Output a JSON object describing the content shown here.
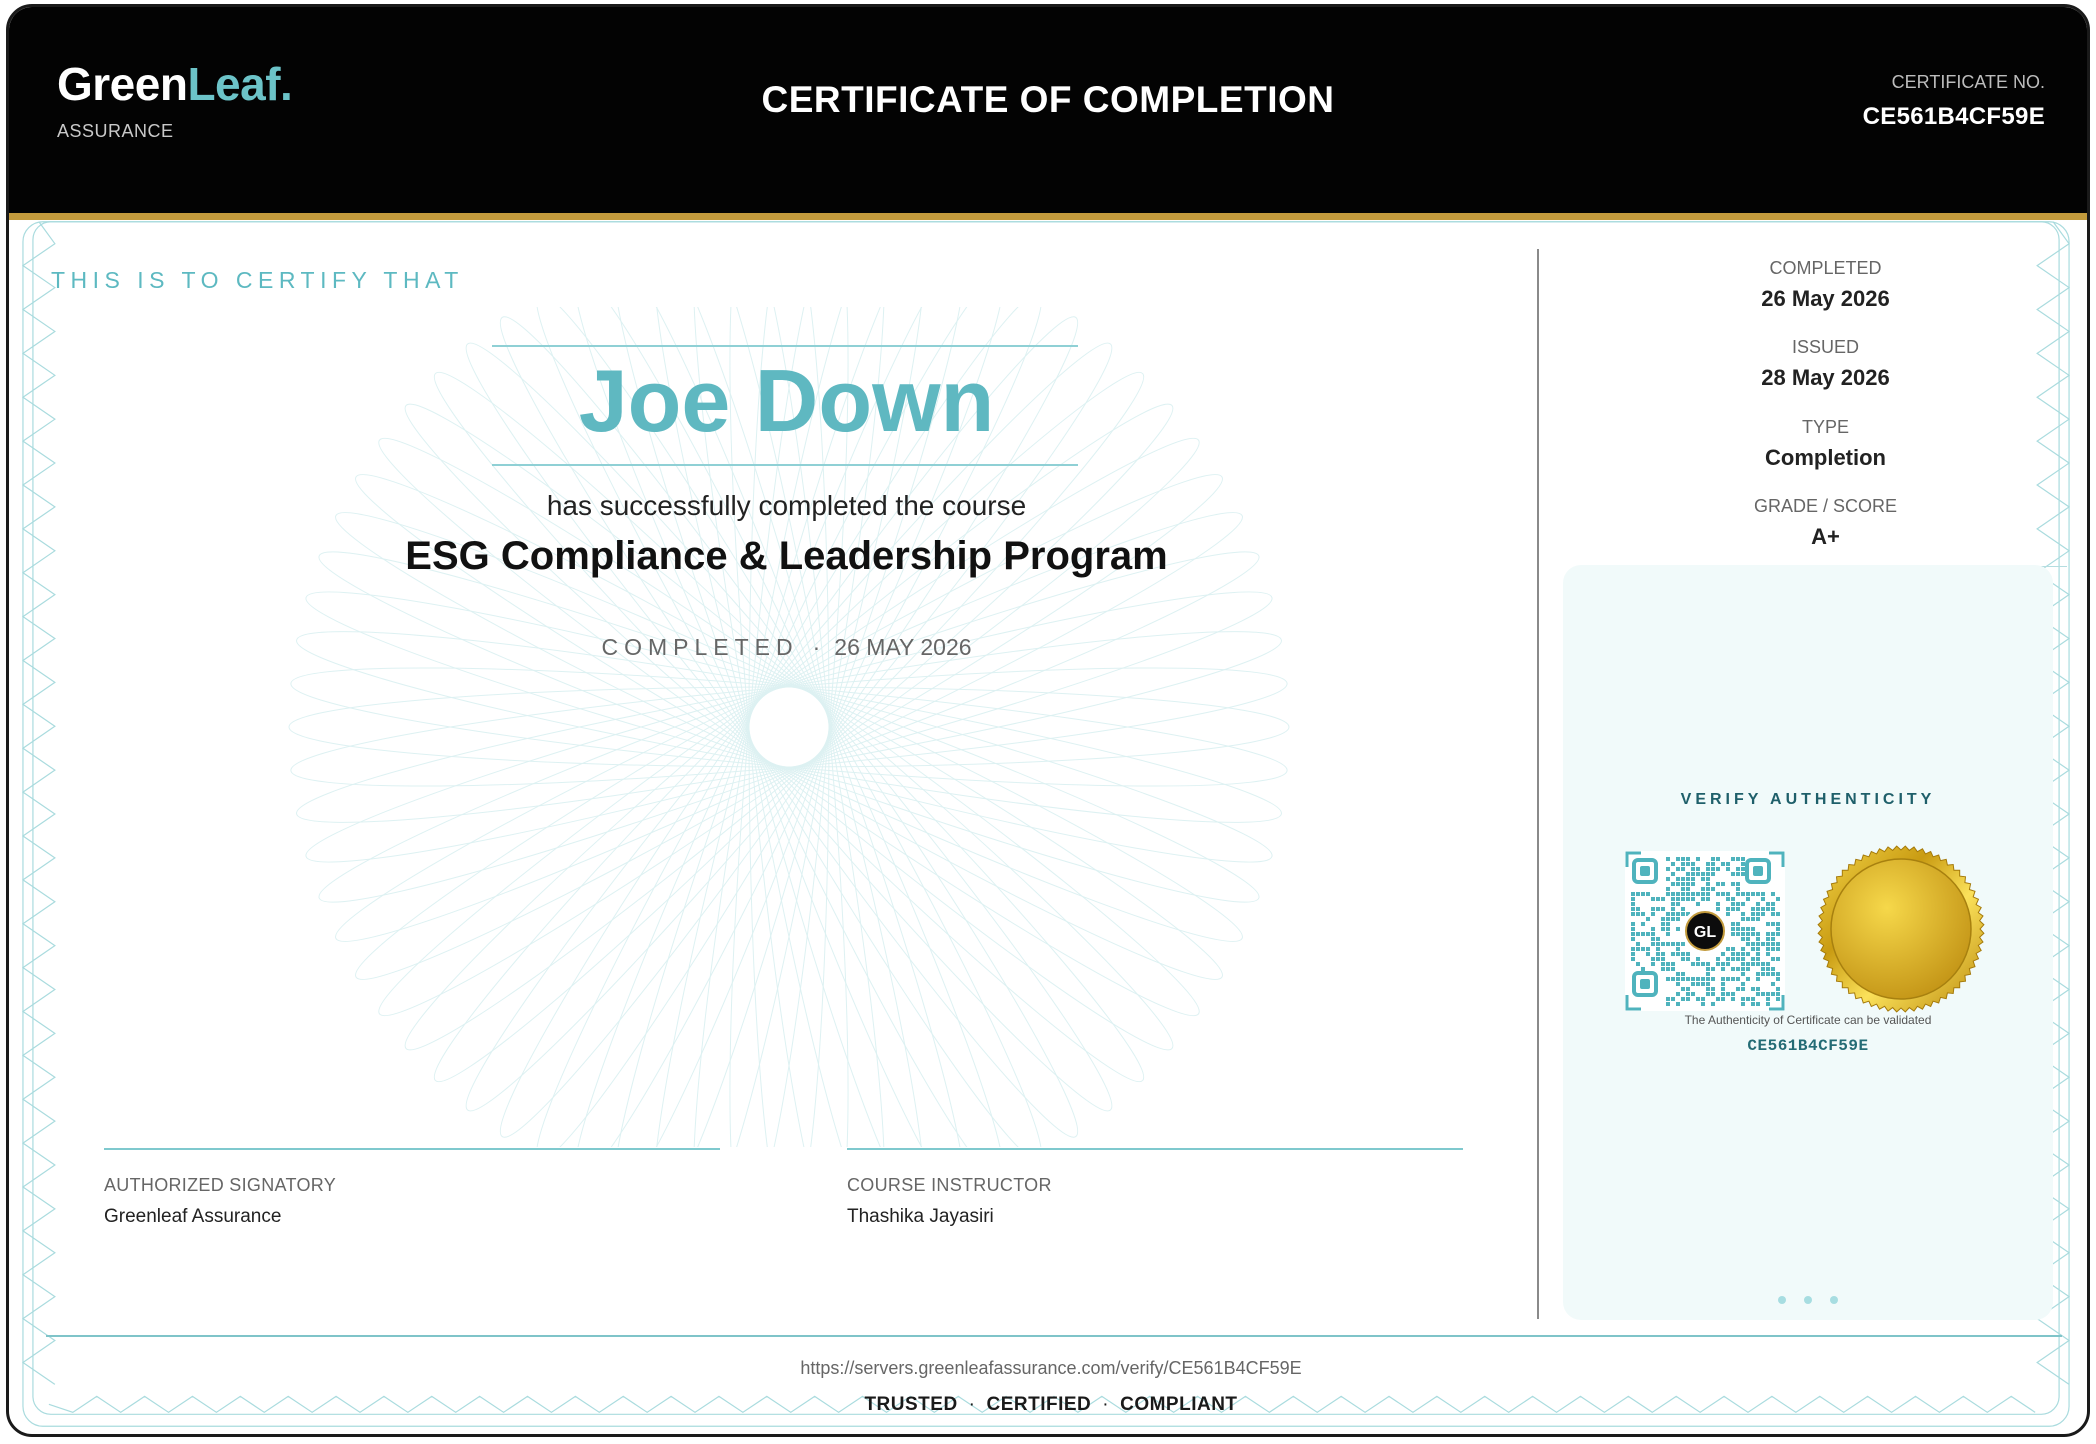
{
  "brand": {
    "name_part1": "Green",
    "name_part2": "Leaf.",
    "subtitle": "ASSURANCE"
  },
  "header": {
    "title": "CERTIFICATE OF COMPLETION",
    "certificate_no_label": "CERTIFICATE NO.",
    "certificate_no": "CE561B4CF59E"
  },
  "body": {
    "certify_text": "THIS IS TO CERTIFY THAT",
    "recipient_name": "Joe Down",
    "intro": "has successfully completed the course",
    "course_title": "ESG Compliance & Leadership Program",
    "completed_label": "COMPLETED",
    "completed_date": "26 MAY 2026"
  },
  "signatures": [
    {
      "role": "AUTHORIZED SIGNATORY",
      "name": "Greenleaf Assurance"
    },
    {
      "role": "COURSE INSTRUCTOR",
      "name": "Thashika Jayasiri"
    }
  ],
  "meta": [
    {
      "label": "COMPLETED",
      "value": "26 May 2026"
    },
    {
      "label": "ISSUED",
      "value": "28 May 2026"
    },
    {
      "label": "TYPE",
      "value": "Completion"
    },
    {
      "label": "GRADE / SCORE",
      "value": "A+"
    }
  ],
  "verify": {
    "title": "VERIFY AUTHENTICITY",
    "qr_logo": "GL",
    "note": "The Authenticity of Certificate can be validated",
    "code": "CE561B4CF59E"
  },
  "footer": {
    "url": "https://servers.greenleafassurance.com/verify/CE561B4CF59E",
    "tags": [
      "TRUSTED",
      "CERTIFIED",
      "COMPLIANT"
    ]
  },
  "colors": {
    "accent": "#5fb8c1",
    "header_bg": "#030303",
    "gold": "#c29a3c",
    "panel_bg": "#f1fafa"
  },
  "icons": [
    "qr-code-icon",
    "gold-seal-icon"
  ]
}
